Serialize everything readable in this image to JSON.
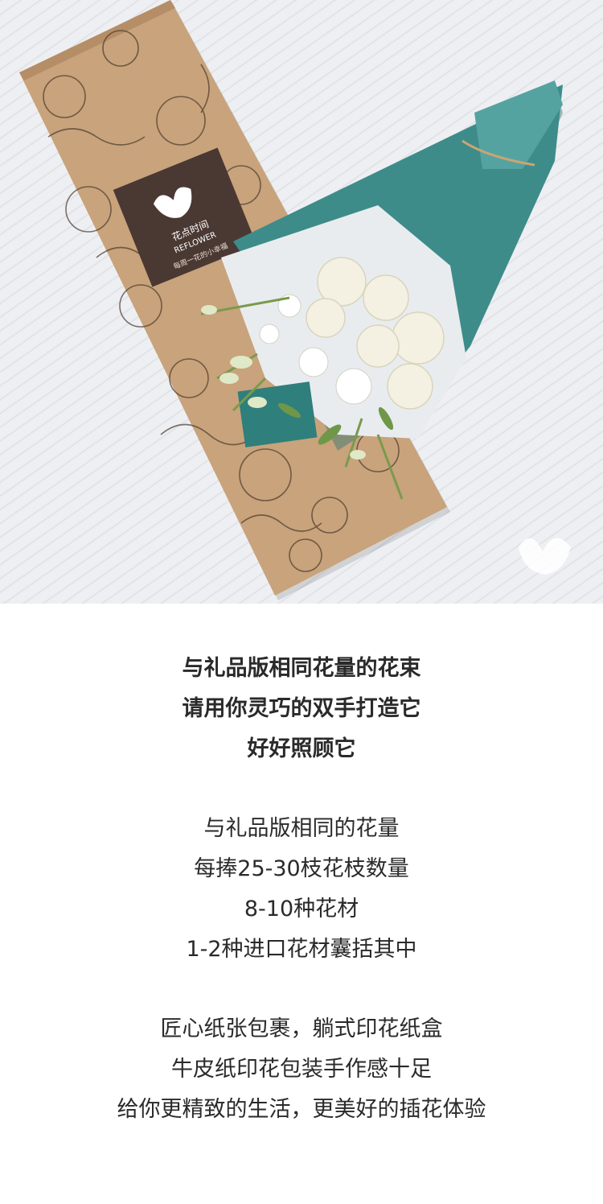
{
  "photo": {
    "box_brand_name": "花点时间",
    "box_brand_latin": "REFLOWER",
    "box_tagline": "每周一花的小幸福",
    "colors": {
      "kraft": "#c7a27a",
      "label": "#4a3833",
      "wrap_teal": "#3d8c8a",
      "background": "#eeeff2"
    },
    "watermark_icon": "butterfly-logo-icon"
  },
  "section1": {
    "line1": "与礼品版相同花量的花束",
    "line2": "请用你灵巧的双手打造它",
    "line3": "好好照顾它"
  },
  "section2": {
    "line1": "与礼品版相同的花量",
    "line2": "每捧25-30枝花枝数量",
    "line3": "8-10种花材",
    "line4": "1-2种进口花材囊括其中"
  },
  "section3": {
    "line1": "匠心纸张包裹，躺式印花纸盒",
    "line2": "牛皮纸印花包装手作感十足",
    "line3": "给你更精致的生活，更美好的插花体验"
  }
}
